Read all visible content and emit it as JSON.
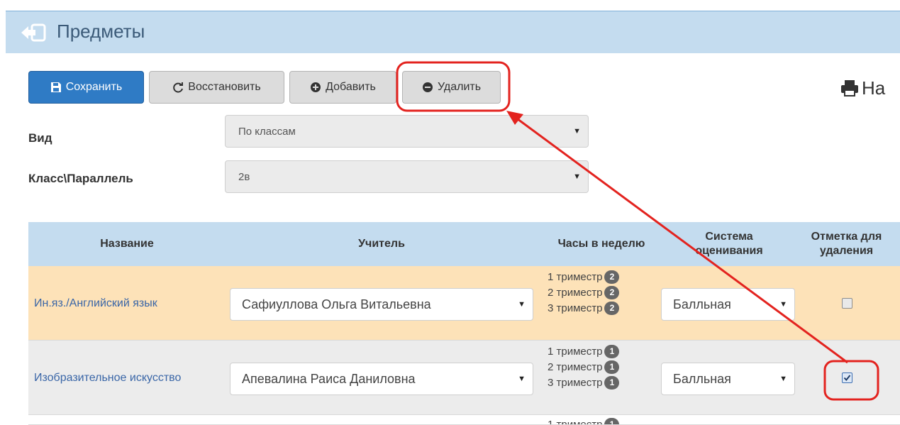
{
  "header": {
    "title": "Предметы"
  },
  "toolbar": {
    "save_label": "Сохранить",
    "restore_label": "Восстановить",
    "add_label": "Добавить",
    "delete_label": "Удалить",
    "print_label": "На"
  },
  "filters": {
    "view_label": "Вид",
    "view_value": "По классам",
    "class_label": "Класс\\Параллель",
    "class_value": "2в"
  },
  "table": {
    "columns": [
      "Название",
      "Учитель",
      "Часы в неделю",
      "Система\nоценивания",
      "Отметка для\nудаления"
    ],
    "rows": [
      {
        "subject": "Ин.яз./Английский язык",
        "teacher": "Сафиуллова Ольга Витальевна",
        "hours": [
          {
            "term": "1 триместр",
            "count": "2"
          },
          {
            "term": "2 триместр",
            "count": "2"
          },
          {
            "term": "3 триместр",
            "count": "2"
          }
        ],
        "grading": "Балльная",
        "marked": false
      },
      {
        "subject": "Изобразительное искусство",
        "teacher": "Апевалина Раиса Даниловна",
        "hours": [
          {
            "term": "1 триместр",
            "count": "1"
          },
          {
            "term": "2 триместр",
            "count": "1"
          },
          {
            "term": "3 триместр",
            "count": "1"
          }
        ],
        "grading": "Балльная",
        "marked": true
      },
      {
        "hours": [
          {
            "term": "1 триместр",
            "count": "1"
          }
        ]
      }
    ]
  },
  "colors": {
    "header_bg": "#c4dcef",
    "primary_button": "#2f7bc5",
    "highlight_row": "#fde2b8",
    "annotation_red": "#e3231f"
  },
  "icons": {
    "back": "back-arrow-icon",
    "save": "floppy-disk-icon",
    "restore": "refresh-icon",
    "add": "plus-circle-icon",
    "delete": "minus-circle-icon",
    "print": "printer-icon"
  }
}
